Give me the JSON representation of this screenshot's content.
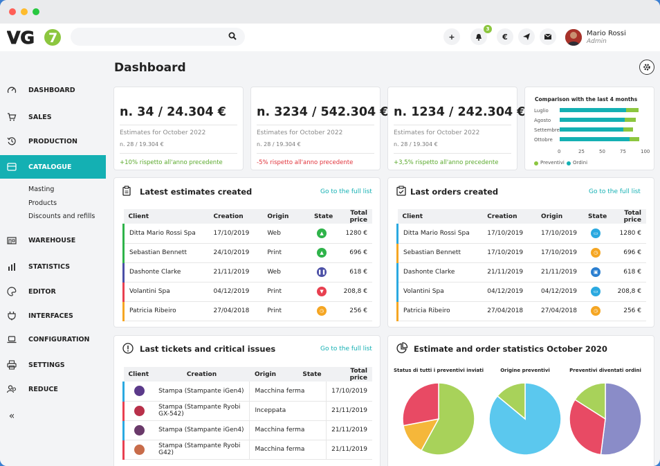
{
  "app": {
    "user_name": "Mario Rossi",
    "user_role": "Admin",
    "notification_count": "3",
    "logo": "VG7",
    "currency_symbol": "€"
  },
  "page": {
    "title": "Dashboard"
  },
  "sidebar": {
    "items": [
      {
        "label": "DASHBOARD",
        "icon": "speedometer-icon"
      },
      {
        "label": "SALES",
        "icon": "cart-icon"
      },
      {
        "label": "PRODUCTION",
        "icon": "history-icon"
      },
      {
        "label": "CATALOGUE",
        "icon": "catalogue-icon"
      },
      {
        "label": "WAREHOUSE",
        "icon": "warehouse-icon"
      },
      {
        "label": "STATISTICS",
        "icon": "stats-icon"
      },
      {
        "label": "EDITOR",
        "icon": "palette-icon"
      },
      {
        "label": "INTERFACES",
        "icon": "plug-icon"
      },
      {
        "label": "CONFIGURATION",
        "icon": "laptop-icon"
      },
      {
        "label": "SETTINGS",
        "icon": "printer-icon"
      },
      {
        "label": "REDUCE",
        "icon": "users-icon"
      }
    ],
    "subitems": [
      "Masting",
      "Products",
      "Discounts and refills"
    ],
    "collapse": "«"
  },
  "kpis": [
    {
      "value": "n. 34 / 24.304 €",
      "label": "Estimates for October 2022",
      "sub": "n. 28 / 19.304 €",
      "trend": "+10% rispetto all'anno precedente",
      "trend_color": "#5aa92c"
    },
    {
      "value": "n. 3234 / 542.304 €",
      "label": "Estimates for October 2022",
      "sub": "n. 28 / 19.304 €",
      "trend": "-5% rispetto all'anno precedente",
      "trend_color": "#e0323a"
    },
    {
      "value": "n. 1234 / 242.304 €",
      "label": "Estimates for October 2022",
      "sub": "n. 28 / 19.304 €",
      "trend": "+3,5% rispetto all'anno precedente",
      "trend_color": "#5aa92c"
    }
  ],
  "comparison": {
    "title": "Comparison with the last 4 months",
    "rows": [
      {
        "label": "Luglio",
        "ordini": 80,
        "preventivi": 95
      },
      {
        "label": "Agosto",
        "ordini": 78,
        "preventivi": 92
      },
      {
        "label": "Settembre",
        "ordini": 77,
        "preventivi": 88
      },
      {
        "label": "Ottobre",
        "ordini": 84,
        "preventivi": 96
      }
    ],
    "ticks": [
      "0",
      "25",
      "50",
      "75",
      "100"
    ],
    "legend": [
      "Preventivi",
      "Ordini"
    ],
    "colors": {
      "preventivi": "#8cc63f",
      "ordini": "#14b0b3"
    }
  },
  "estimates": {
    "title": "Latest estimates created",
    "link": "Go to the full list",
    "headers": [
      "Client",
      "Creation",
      "Origin",
      "State",
      "Total price"
    ],
    "rows": [
      {
        "client": "Ditta Mario Rossi Spa",
        "creation": "17/10/2019",
        "origin": "Web",
        "price": "1280 €",
        "accent": "#2fb34a",
        "state_color": "#2fb34a",
        "state_icon": "thumbs-up-icon"
      },
      {
        "client": "Sebastian Bennett",
        "creation": "24/10/2019",
        "origin": "Print",
        "price": "696 €",
        "accent": "#2fb34a",
        "state_color": "#2fb34a",
        "state_icon": "thumbs-up-icon"
      },
      {
        "client": "Dashonte Clarke",
        "creation": "21/11/2019",
        "origin": "Web",
        "price": "618 €",
        "accent": "#4b4fa6",
        "state_color": "#4b4fa6",
        "state_icon": "pause-icon"
      },
      {
        "client": "Volantini Spa",
        "creation": "04/12/2019",
        "origin": "Print",
        "price": "208,8 €",
        "accent": "#e84050",
        "state_color": "#e84050",
        "state_icon": "thumbs-down-icon"
      },
      {
        "client": "Patricia Ribeiro",
        "creation": "27/04/2018",
        "origin": "Print",
        "price": "256 €",
        "accent": "#f5a623",
        "state_color": "#f5a623",
        "state_icon": "clock-icon"
      }
    ]
  },
  "orders": {
    "title": "Last orders created",
    "link": "Go to the full list",
    "headers": [
      "Client",
      "Creation",
      "Origin",
      "State",
      "Total price"
    ],
    "rows": [
      {
        "client": "Ditta Mario Rossi Spa",
        "creation": "17/10/2019",
        "origin": "17/10/2019",
        "price": "1280 €",
        "accent": "#2ba9e0",
        "state_color": "#2ba9e0",
        "state_icon": "inbox-icon"
      },
      {
        "client": "Sebastian Bennett",
        "creation": "17/10/2019",
        "origin": "17/10/2019",
        "price": "696 €",
        "accent": "#f5a623",
        "state_color": "#f5a623",
        "state_icon": "clock-icon"
      },
      {
        "client": "Dashonte Clarke",
        "creation": "21/11/2019",
        "origin": "21/11/2019",
        "price": "618 €",
        "accent": "#2ba9e0",
        "state_color": "#2b7fd0",
        "state_icon": "box-icon"
      },
      {
        "client": "Volantini Spa",
        "creation": "04/12/2019",
        "origin": "04/12/2019",
        "price": "208,8 €",
        "accent": "#2ba9e0",
        "state_color": "#2ba9e0",
        "state_icon": "inbox-icon"
      },
      {
        "client": "Patricia Ribeiro",
        "creation": "27/04/2018",
        "origin": "27/04/2018",
        "price": "256 €",
        "accent": "#f5a623",
        "state_color": "#f5a623",
        "state_icon": "clock-icon"
      }
    ]
  },
  "tickets": {
    "title": "Last tickets and critical issues",
    "link": "Go to the full list",
    "headers": [
      "Client",
      "Creation",
      "Origin",
      "State",
      "Total price"
    ],
    "rows": [
      {
        "creation": "Stampa (Stampante iGen4)",
        "origin": "Macchina ferma",
        "date": "17/10/2019",
        "accent": "#2ba9e0"
      },
      {
        "creation": "Stampa (Stampante Ryobi GX-542)",
        "origin": "Inceppata",
        "date": "21/11/2019",
        "accent": "#e84050"
      },
      {
        "creation": "Stampa (Stampante iGen4)",
        "origin": "Macchina ferma",
        "date": "21/11/2019",
        "accent": "#2ba9e0"
      },
      {
        "creation": "Stampa (Stampante Ryobi G42)",
        "origin": "Macchina ferma",
        "date": "21/11/2019",
        "accent": "#e84050"
      }
    ]
  },
  "stats": {
    "title": "Estimate and order statistics October 2020",
    "pies": [
      {
        "title": "Status di tutti i preventivi inviati",
        "slices": [
          {
            "value": 58,
            "color": "#a8d25a"
          },
          {
            "value": 14,
            "color": "#f5b73a"
          },
          {
            "value": 28,
            "color": "#e84a64"
          }
        ]
      },
      {
        "title": "Origine preventivi",
        "slices": [
          {
            "value": 86,
            "color": "#5bc8ee"
          },
          {
            "value": 14,
            "color": "#a8d25a"
          }
        ]
      },
      {
        "title": "Preventivi diventati ordini",
        "slices": [
          {
            "value": 52,
            "color": "#8a8cc8"
          },
          {
            "value": 32,
            "color": "#e84a64"
          },
          {
            "value": 16,
            "color": "#a8d25a"
          }
        ]
      }
    ]
  }
}
